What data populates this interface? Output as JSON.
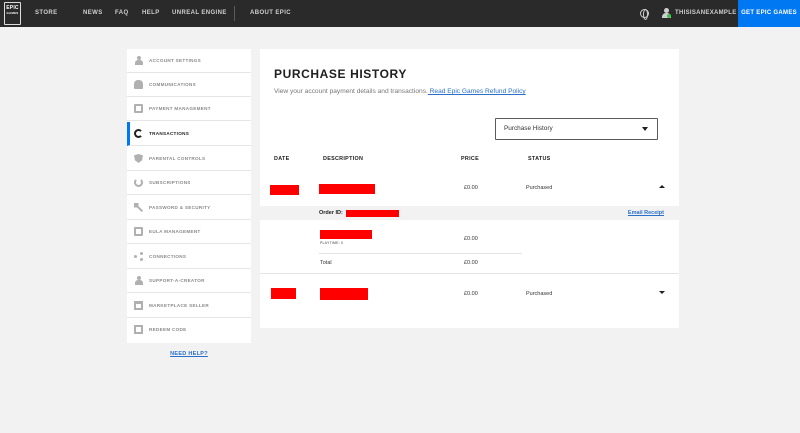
{
  "topbar": {
    "logo_line1": "EPIC",
    "logo_line2": "GAMES",
    "nav": [
      "STORE",
      "NEWS",
      "FAQ",
      "HELP",
      "UNREAL ENGINE",
      "ABOUT EPIC"
    ],
    "username": "THISISANEXAMPLE",
    "cta": "GET EPIC GAMES"
  },
  "sidebar": {
    "items": [
      {
        "label": "ACCOUNT SETTINGS",
        "icon": "person-icon"
      },
      {
        "label": "COMMUNICATIONS",
        "icon": "bell-icon"
      },
      {
        "label": "PAYMENT MANAGEMENT",
        "icon": "card-icon"
      },
      {
        "label": "TRANSACTIONS",
        "icon": "history-icon"
      },
      {
        "label": "PARENTAL CONTROLS",
        "icon": "shield-icon"
      },
      {
        "label": "SUBSCRIPTIONS",
        "icon": "refresh-icon"
      },
      {
        "label": "PASSWORD & SECURITY",
        "icon": "key-icon"
      },
      {
        "label": "EULA MANAGEMENT",
        "icon": "document-icon"
      },
      {
        "label": "CONNECTIONS",
        "icon": "share-icon"
      },
      {
        "label": "SUPPORT-A-CREATOR",
        "icon": "person-icon"
      },
      {
        "label": "MARKETPLACE SELLER",
        "icon": "store-icon"
      },
      {
        "label": "REDEEM CODE",
        "icon": "gift-icon"
      }
    ],
    "active_index": 3,
    "need_help": "NEED HELP?"
  },
  "main": {
    "title": "PURCHASE HISTORY",
    "subtitle": "View your account payment details and transactions.",
    "refund_link": " Read Epic Games Refund Policy",
    "filter_value": "Purchase History",
    "columns": {
      "date": "DATE",
      "description": "DESCRIPTION",
      "price": "PRICE",
      "status": "STATUS"
    },
    "rows": [
      {
        "price": "£0.00",
        "status": "Purchased",
        "expanded": true
      },
      {
        "price": "£0.00",
        "status": "Purchased",
        "expanded": false
      }
    ],
    "detail": {
      "order_label": "Order ID:",
      "email_receipt": "Email Receipt",
      "item_price": "£0.00",
      "item_platform": "PLAYTIME: 0",
      "total_label": "Total",
      "total_price": "£0.00"
    }
  },
  "colors": {
    "accent": "#0078f2",
    "redaction": "#ff0000",
    "topbar": "#2a2a2a"
  }
}
